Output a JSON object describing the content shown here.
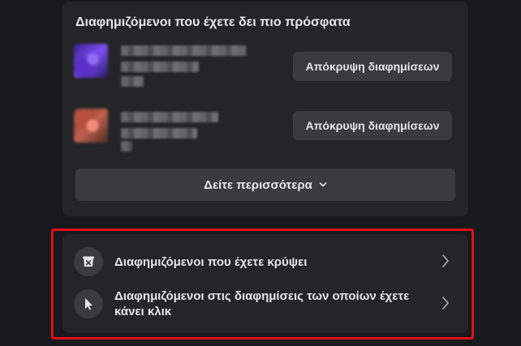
{
  "recent_advertisers": {
    "title": "Διαφημιζόμενοι που έχετε δει πιο πρόσφατα",
    "items": [
      {
        "hide_label": "Απόκρυψη διαφημίσεων"
      },
      {
        "hide_label": "Απόκρυψη διαφημίσεων"
      }
    ],
    "see_more_label": "Δείτε περισσότερα"
  },
  "advertiser_links": [
    {
      "label": "Διαφημιζόμενοι που έχετε κρύψει",
      "icon": "hidden-ads-icon"
    },
    {
      "label": "Διαφημιζόμενοι στις διαφημίσεις των οποίων έχετε κάνει κλικ",
      "icon": "cursor-icon"
    }
  ],
  "colors": {
    "background": "#18191a",
    "card": "#242526",
    "button": "#3a3b3c",
    "text": "#e4e6eb",
    "highlight": "#e0101a"
  }
}
